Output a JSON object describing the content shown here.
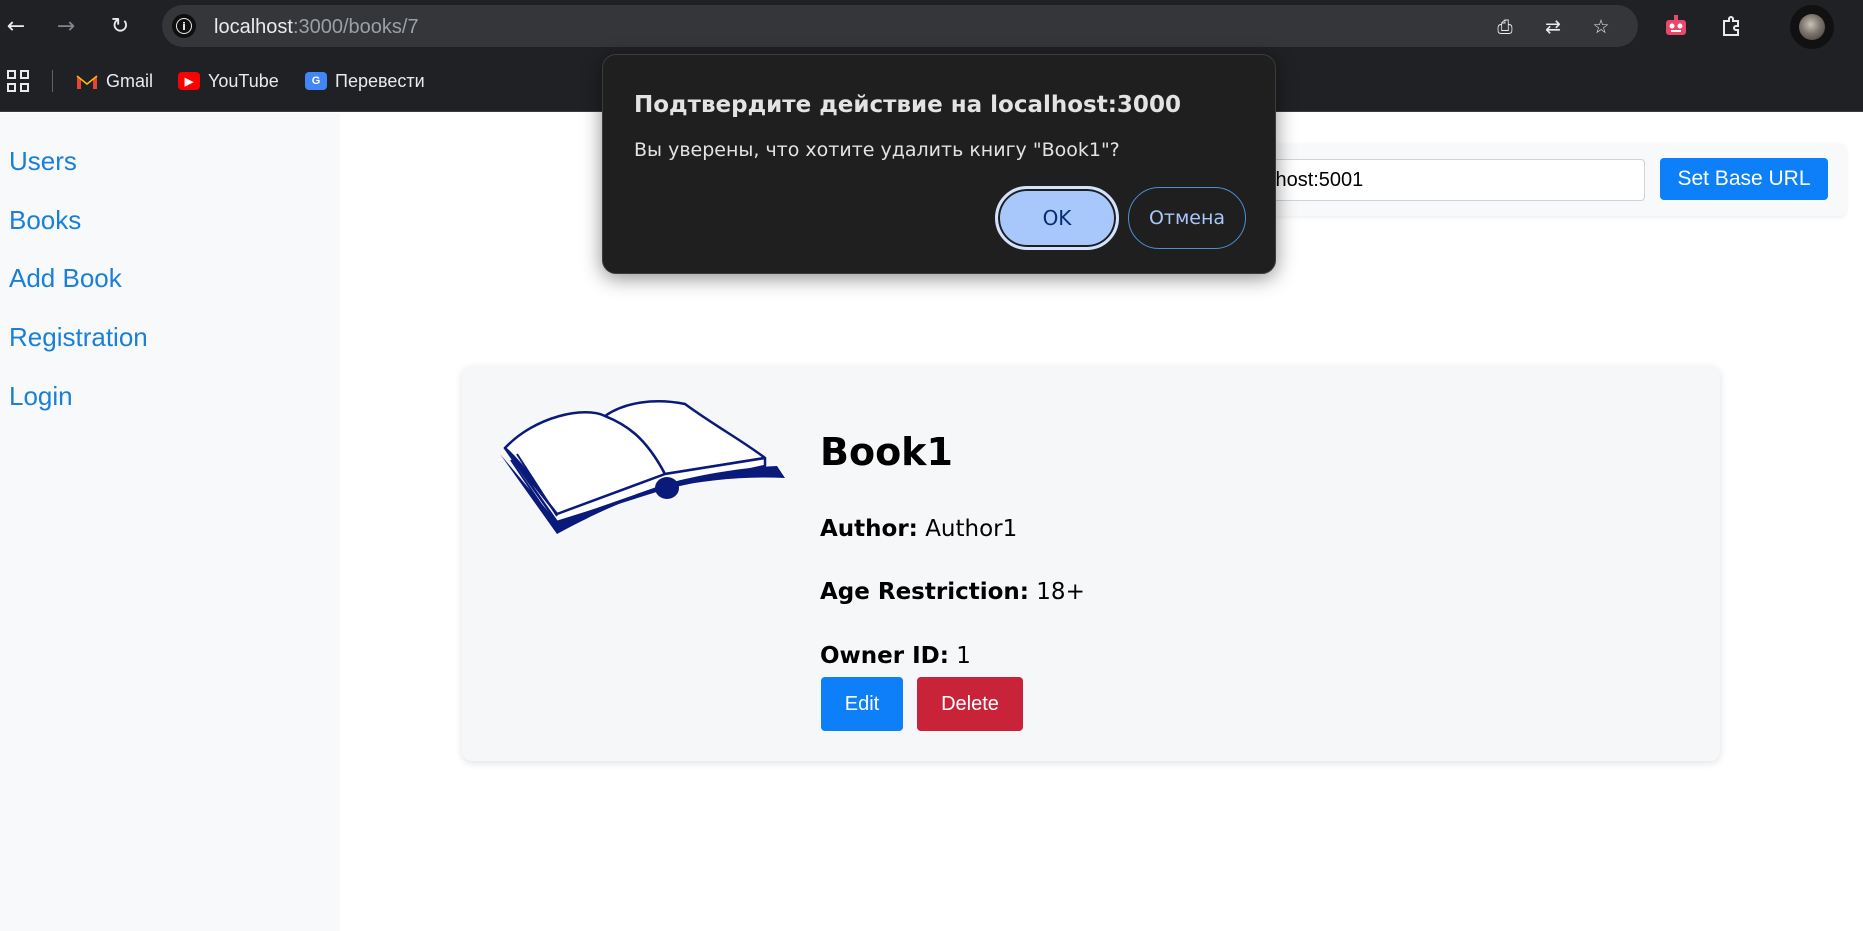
{
  "browser": {
    "url_host": "localhost",
    "url_rest": ":3000/books/7",
    "icons": {
      "back": "arrow-left-icon",
      "forward": "arrow-right-icon",
      "reload": "reload-icon",
      "install": "install-app-icon",
      "translate": "translate-icon",
      "bookmark": "star-icon",
      "extension1": "robot-extension-icon",
      "extensions": "puzzle-icon"
    },
    "bookmarks": [
      {
        "label": "Gmail",
        "icon": "gmail-icon"
      },
      {
        "label": "YouTube",
        "icon": "youtube-icon"
      },
      {
        "label": "Перевести",
        "icon": "google-translate-icon"
      }
    ]
  },
  "sidebar": {
    "items": [
      {
        "label": "Users"
      },
      {
        "label": "Books"
      },
      {
        "label": "Add Book"
      },
      {
        "label": "Registration"
      },
      {
        "label": "Login"
      }
    ]
  },
  "base_url_form": {
    "input_value": "lhost:5001",
    "button_label": "Set Base URL"
  },
  "book": {
    "title": "Book1",
    "author_label": "Author:",
    "author": "Author1",
    "age_label": "Age Restriction:",
    "age": "18+",
    "owner_label": "Owner ID:",
    "owner": "1",
    "edit_label": "Edit",
    "delete_label": "Delete"
  },
  "dialog": {
    "title": "Подтвердите действие на localhost:3000",
    "message": "Вы уверены, что хотите удалить книгу \"Book1\"?",
    "ok_label": "OK",
    "cancel_label": "Отмена"
  },
  "colors": {
    "link": "#1a7fd7",
    "primary": "#0d7ff8",
    "danger": "#c9233a",
    "dialog_bg": "#1f1f1f",
    "book_ink": "#0a1a7a"
  }
}
